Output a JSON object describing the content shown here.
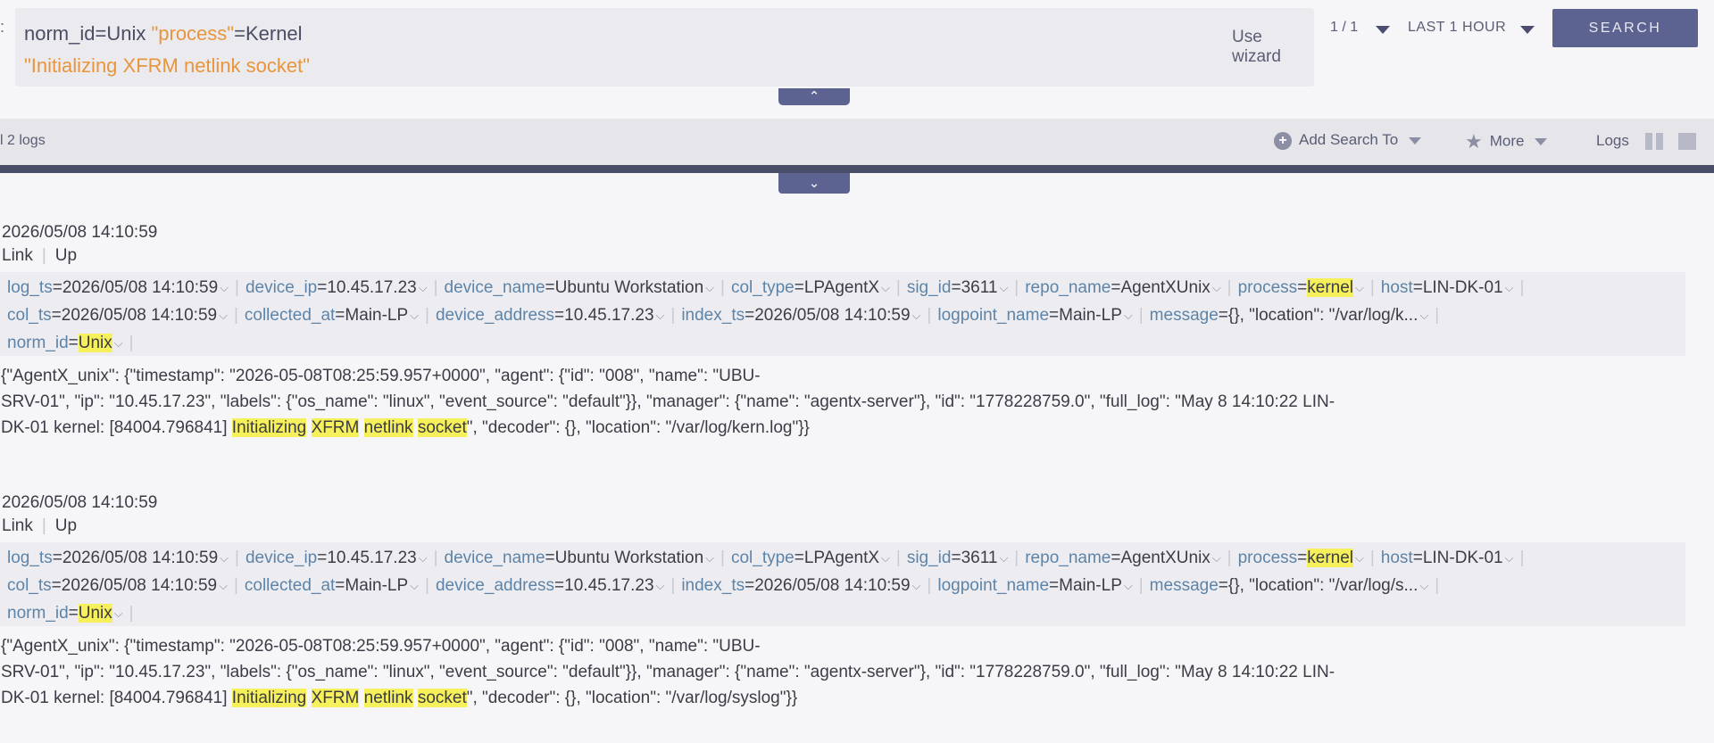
{
  "query": {
    "line1": {
      "p1": "norm_id=Unix ",
      "p2": "\"process\"",
      "p3": "=Kernel"
    },
    "line2": "\"Initializing XFRM netlink socket\""
  },
  "header": {
    "edge_glyph": ":",
    "use_wizard": "Use wizard",
    "pager": "1 / 1",
    "time_range": "LAST 1 HOUR",
    "search_button": "SEARCH"
  },
  "toolbar": {
    "logs_count": "l 2 logs",
    "add_search": "Add Search To",
    "more": "More",
    "logs_label": "Logs"
  },
  "icons": {
    "collapse": "double-chevron-up",
    "expand": "double-chevron-down",
    "add": "plus-circle",
    "more": "star",
    "dropdown": "triangle-down"
  },
  "colors": {
    "accent": "#5d6390",
    "field_key": "#5d84a8",
    "highlight": "#f6f05a",
    "query_string": "#e8953c"
  },
  "entries": [
    {
      "timestamp": "2026/05/08 14:10:59",
      "actions": {
        "link": "Link",
        "up": "Up"
      },
      "rows": [
        [
          {
            "key": "log_ts",
            "value": "2026/05/08 14:10:59"
          },
          {
            "key": "device_ip",
            "value": "10.45.17.23"
          },
          {
            "key": "device_name",
            "value": "Ubuntu Workstation"
          },
          {
            "key": "col_type",
            "value": "LPAgentX"
          },
          {
            "key": "sig_id",
            "value": "3611"
          },
          {
            "key": "repo_name",
            "value": "AgentXUnix"
          },
          {
            "key": "process",
            "value": "kernel",
            "hl": true
          },
          {
            "key": "host",
            "value": "LIN-DK-01"
          }
        ],
        [
          {
            "key": "col_ts",
            "value": "2026/05/08 14:10:59"
          },
          {
            "key": "collected_at",
            "value": "Main-LP"
          },
          {
            "key": "device_address",
            "value": "10.45.17.23"
          },
          {
            "key": "index_ts",
            "value": "2026/05/08 14:10:59"
          },
          {
            "key": "logpoint_name",
            "value": "Main-LP"
          },
          {
            "key": "message",
            "value": "{}, \"location\": \"/var/log/k..."
          }
        ],
        [
          {
            "key": "norm_id",
            "value": "Unix",
            "hl": true
          }
        ]
      ],
      "raw": {
        "l1": "{\"AgentX_unix\": {\"timestamp\": \"2026-05-08T08:25:59.957+0000\", \"agent\": {\"id\": \"008\", \"name\": \"UBU-",
        "l2": "SRV-01\", \"ip\": \"10.45.17.23\", \"labels\": {\"os_name\": \"linux\", \"event_source\": \"default\"}}, \"manager\": {\"name\": \"agentx-server\"}, \"id\": \"1778228759.0\", \"full_log\": \"May  8 14:10:22 LIN-",
        "l3_pre": "DK-01 kernel: [84004.796841] ",
        "w1": "Initializing",
        "w2": "XFRM",
        "w3": "netlink",
        "w4": "socket",
        "l3_post": "\", \"decoder\": {}, \"location\": \"/var/log/kern.log\"}}"
      }
    },
    {
      "timestamp": "2026/05/08 14:10:59",
      "actions": {
        "link": "Link",
        "up": "Up"
      },
      "rows": [
        [
          {
            "key": "log_ts",
            "value": "2026/05/08 14:10:59"
          },
          {
            "key": "device_ip",
            "value": "10.45.17.23"
          },
          {
            "key": "device_name",
            "value": "Ubuntu Workstation"
          },
          {
            "key": "col_type",
            "value": "LPAgentX"
          },
          {
            "key": "sig_id",
            "value": "3611"
          },
          {
            "key": "repo_name",
            "value": "AgentXUnix"
          },
          {
            "key": "process",
            "value": "kernel",
            "hl": true
          },
          {
            "key": "host",
            "value": "LIN-DK-01"
          }
        ],
        [
          {
            "key": "col_ts",
            "value": "2026/05/08 14:10:59"
          },
          {
            "key": "collected_at",
            "value": "Main-LP"
          },
          {
            "key": "device_address",
            "value": "10.45.17.23"
          },
          {
            "key": "index_ts",
            "value": "2026/05/08 14:10:59"
          },
          {
            "key": "logpoint_name",
            "value": "Main-LP"
          },
          {
            "key": "message",
            "value": "{}, \"location\": \"/var/log/s..."
          }
        ],
        [
          {
            "key": "norm_id",
            "value": "Unix",
            "hl": true
          }
        ]
      ],
      "raw": {
        "l1": "{\"AgentX_unix\": {\"timestamp\": \"2026-05-08T08:25:59.957+0000\", \"agent\": {\"id\": \"008\", \"name\": \"UBU-",
        "l2": "SRV-01\", \"ip\": \"10.45.17.23\", \"labels\": {\"os_name\": \"linux\", \"event_source\": \"default\"}}, \"manager\": {\"name\": \"agentx-server\"}, \"id\": \"1778228759.0\", \"full_log\": \"May  8 14:10:22 LIN-",
        "l3_pre": "DK-01 kernel: [84004.796841] ",
        "w1": "Initializing",
        "w2": "XFRM",
        "w3": "netlink",
        "w4": "socket",
        "l3_post": "\", \"decoder\": {}, \"location\": \"/var/log/syslog\"}}"
      }
    }
  ]
}
